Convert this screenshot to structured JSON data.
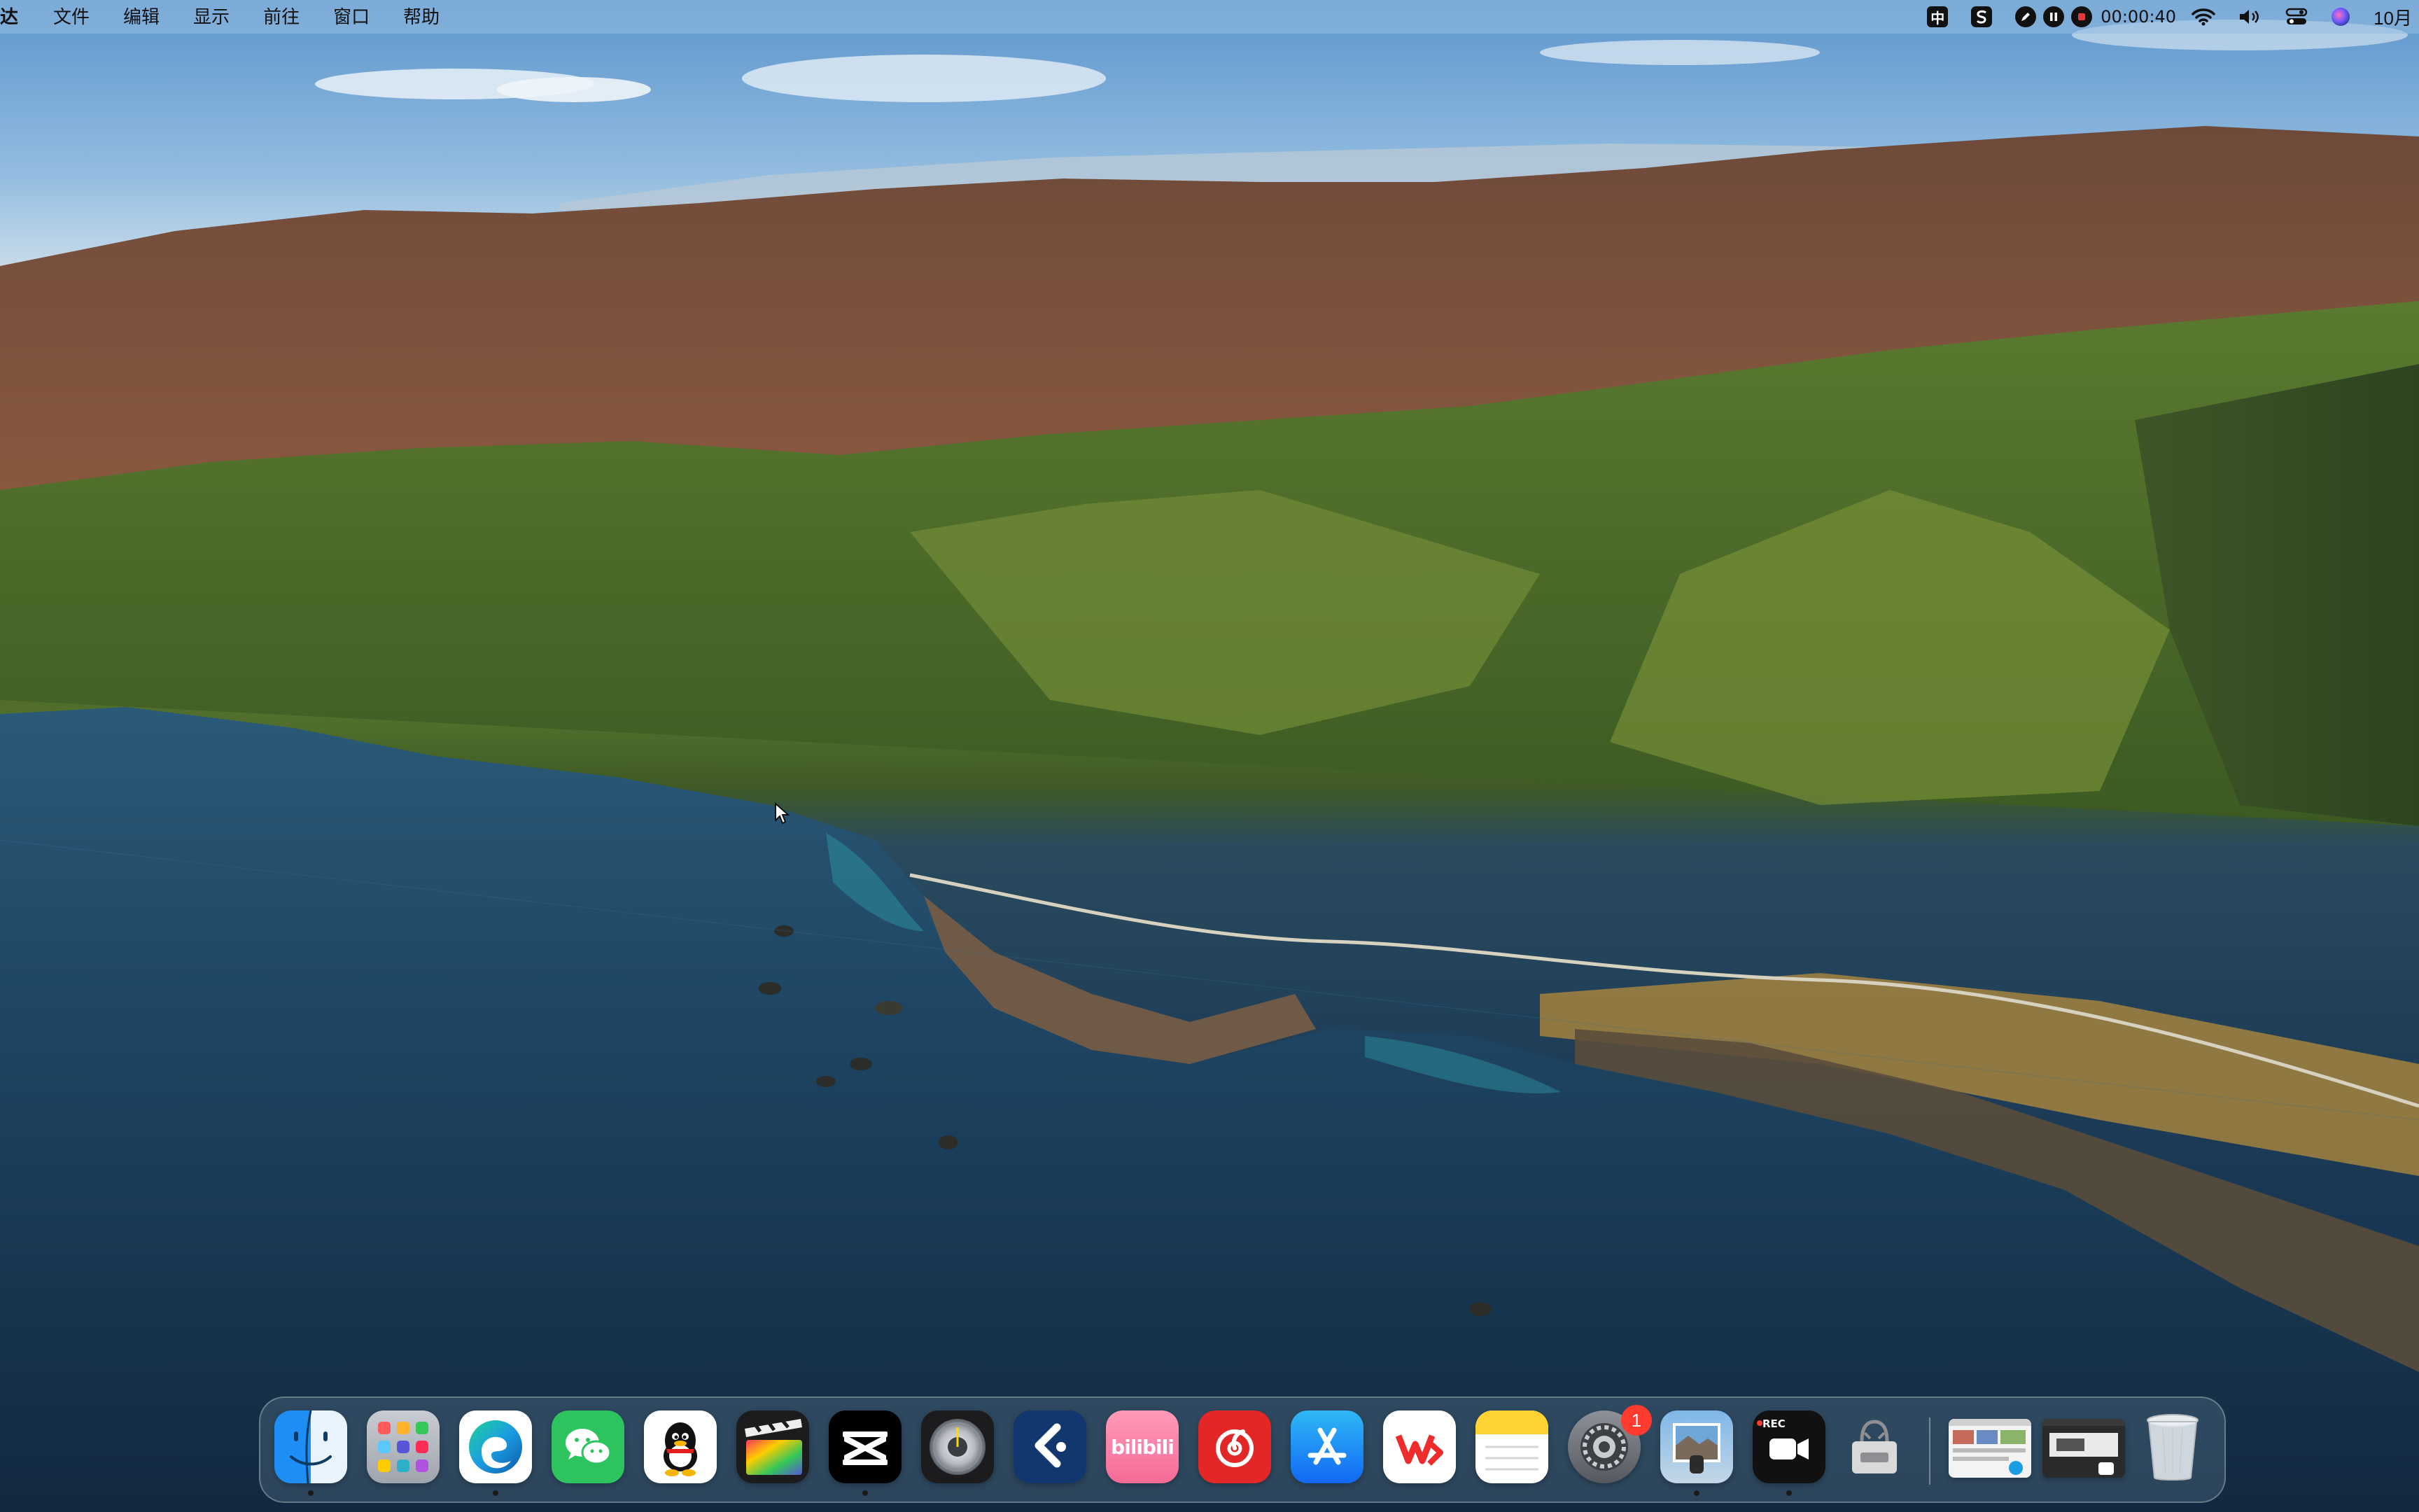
{
  "menubar": {
    "app_name": "达",
    "menus": [
      "文件",
      "编辑",
      "显示",
      "前往",
      "窗口",
      "帮助"
    ],
    "status": {
      "ime": "中",
      "recording_time": "00:00:40",
      "clock": "10月"
    }
  },
  "dock": {
    "apps": [
      {
        "name": "Finder",
        "icon": "finder-icon",
        "running": true
      },
      {
        "name": "Launchpad",
        "icon": "launchpad-icon",
        "running": false
      },
      {
        "name": "Microsoft Edge",
        "icon": "edge-icon",
        "running": true
      },
      {
        "name": "WeChat",
        "icon": "wechat-icon",
        "running": false
      },
      {
        "name": "QQ",
        "icon": "qq-icon",
        "running": false
      },
      {
        "name": "Final Cut Pro",
        "icon": "final-cut-icon",
        "running": false
      },
      {
        "name": "CapCut",
        "icon": "capcut-icon",
        "running": true
      },
      {
        "name": "Logic Pro",
        "icon": "logic-icon",
        "running": false
      },
      {
        "name": "Feishu",
        "icon": "feishu-icon",
        "running": false
      },
      {
        "name": "Bilibili",
        "icon": "bilibili-icon",
        "running": false
      },
      {
        "name": "NetEase Music",
        "icon": "netease-music-icon",
        "running": false
      },
      {
        "name": "App Store",
        "icon": "app-store-icon",
        "running": false
      },
      {
        "name": "WPS",
        "icon": "wps-icon",
        "running": false
      },
      {
        "name": "Notes",
        "icon": "notes-icon",
        "running": false
      },
      {
        "name": "System Settings",
        "icon": "settings-icon",
        "running": false,
        "badge": "1"
      },
      {
        "name": "Preview",
        "icon": "preview-icon",
        "running": true
      },
      {
        "name": "Screen Recorder",
        "icon": "screen-recorder-icon",
        "running": true,
        "label": "REC"
      },
      {
        "name": "Archive Utility",
        "icon": "archive-icon",
        "running": false
      }
    ],
    "recent": [
      {
        "name": "Recent Window 1",
        "icon": "window-thumbnail-icon"
      },
      {
        "name": "Recent Window 2",
        "icon": "window-thumbnail-icon"
      }
    ],
    "trash": {
      "name": "Trash",
      "icon": "trash-icon"
    }
  },
  "apps_text": {
    "bilibili": "bilibili",
    "wps": "W",
    "rec": "REC"
  },
  "colors": {
    "menubar_bg": "#96bee1",
    "dock_bg": "#506e82",
    "badge": "#ff3b30"
  }
}
